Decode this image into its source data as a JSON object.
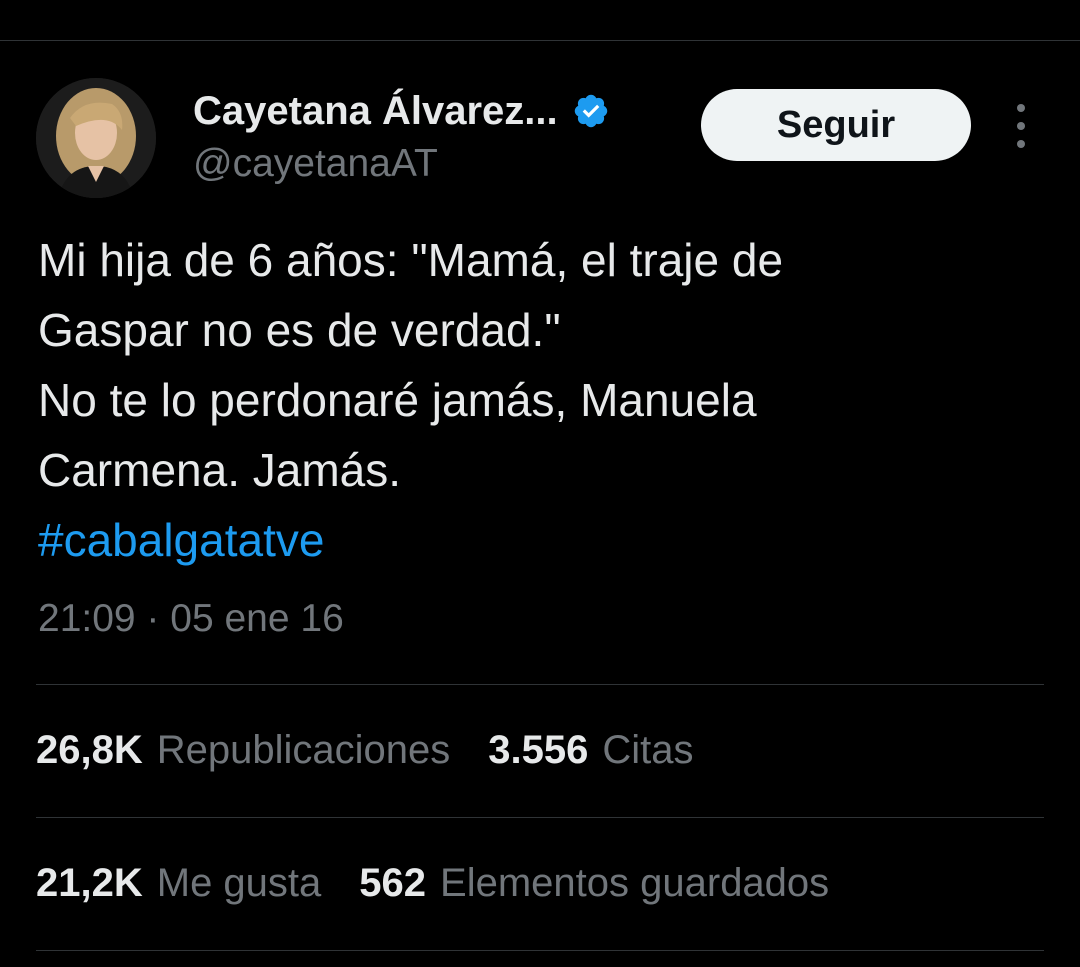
{
  "author": {
    "display_name": "Cayetana Álvarez...",
    "handle": "@cayetanaAT",
    "verified": true
  },
  "follow_button": {
    "label": "Seguir"
  },
  "tweet": {
    "lines": [
      "Mi hija de 6 años: \"Mamá, el traje de",
      "Gaspar no es de verdad.\"",
      "No te lo perdonaré jamás, Manuela",
      "Carmena. Jamás."
    ],
    "hashtag": "#cabalgatatve",
    "timestamp": "21:09 · 05 ene 16"
  },
  "stats": {
    "reposts": {
      "count": "26,8K",
      "label": "Republicaciones"
    },
    "quotes": {
      "count": "3.556",
      "label": "Citas"
    },
    "likes": {
      "count": "21,2K",
      "label": "Me gusta"
    },
    "bookmarks": {
      "count": "562",
      "label": "Elementos guardados"
    }
  },
  "colors": {
    "background": "#000000",
    "text_primary": "#e7e9ea",
    "text_secondary": "#71767b",
    "link": "#1d9bf0",
    "divider": "#2f3336",
    "button_bg": "#eff3f4"
  },
  "icons": {
    "verified": "verified-badge-icon",
    "more": "more-vertical-icon"
  }
}
